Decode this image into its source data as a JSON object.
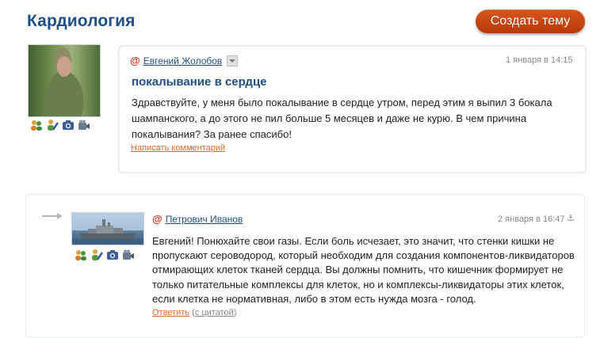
{
  "page": {
    "title": "Кардиология",
    "create_topic_label": "Создать тему"
  },
  "topic": {
    "author": "Евгений Жолобов",
    "date": "1 января в 14:15",
    "title": "покалывание в сердце",
    "body": "Здравствуйте, у меня было покалывание в сердце утром, перед этим я выпил 3 бокала шампанского, а до этого не пил больше 5 месяцев и даже не курю. В чем причина покалывания? За ранее спасибо!",
    "comment_link": "Написать комментарий",
    "icons": [
      "friends-icon",
      "edit-profile-icon",
      "photo-camera-icon",
      "video-camera-icon"
    ]
  },
  "reply": {
    "author": "Петрович Иванов",
    "date": "2 января в 16:47",
    "anchor": "⚓",
    "body": "Евгений! Понюхайте свои газы. Если боль исчезает, это значит, что стенки кишки не пропускают сероводород, который необходим для создания компонентов-ликвидаторов отмирающих клеток тканей сердца. Вы должны помнить, что кишечник формирует не только питательные комплексы для клеток, но и комплексы-ликвидаторы этих клеток, если клетка не нормативная, либо в этом есть нужда мозга - голод.",
    "reply_label": "Ответить",
    "quote_open": "(",
    "quote_label": "с цитатой",
    "quote_close": ")",
    "icons": [
      "friends-icon",
      "edit-profile-icon",
      "photo-camera-icon",
      "video-camera-icon"
    ]
  },
  "colors": {
    "title_blue": "#1f4f86",
    "button_orange": "#c4470f",
    "link_orange": "#e06a2c",
    "at_red": "#d0331b"
  }
}
